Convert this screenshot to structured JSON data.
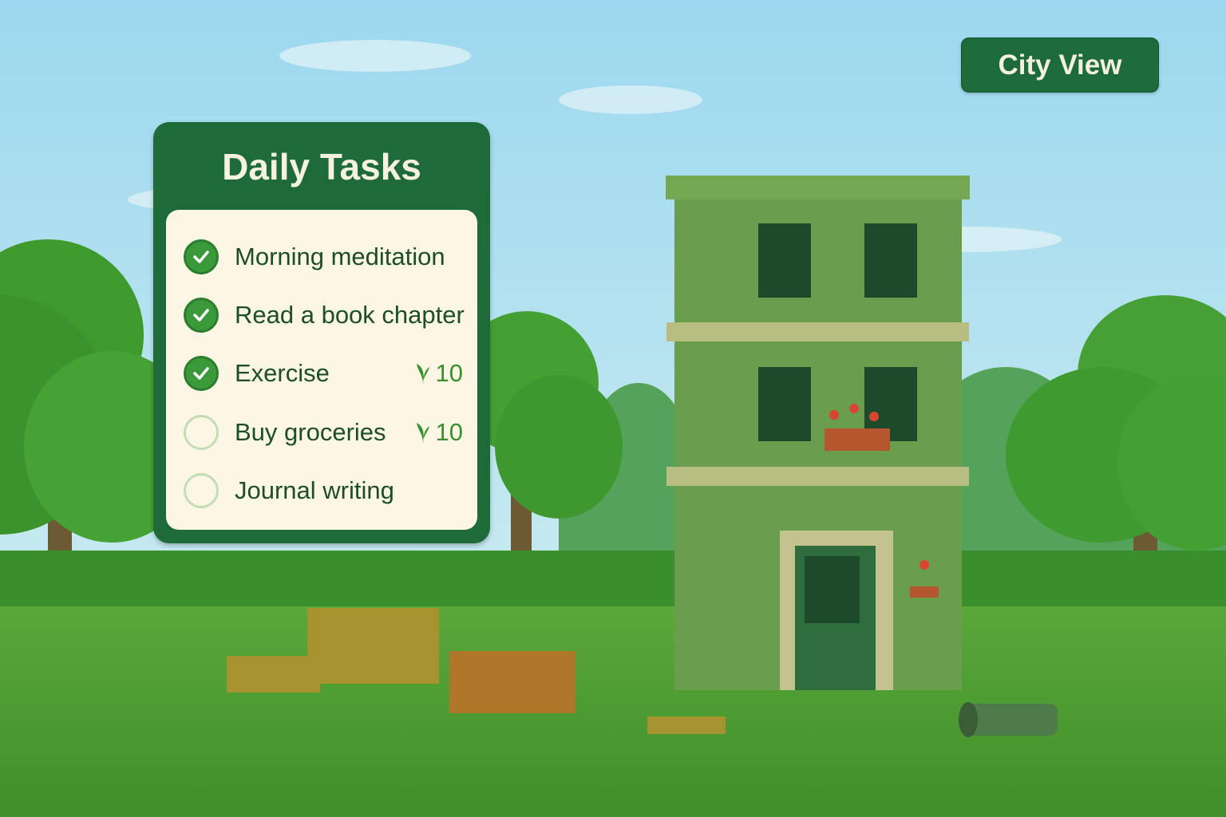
{
  "header": {
    "city_view_label": "City View"
  },
  "daily_tasks": {
    "title": "Daily Tasks",
    "items": [
      {
        "label": "Morning meditation",
        "completed": true,
        "reward": ""
      },
      {
        "label": "Read a book chapter",
        "completed": true,
        "reward": ""
      },
      {
        "label": "Exercise",
        "completed": true,
        "reward": "10"
      },
      {
        "label": "Buy groceries",
        "completed": false,
        "reward": "10"
      },
      {
        "label": "Journal writing",
        "completed": false,
        "reward": ""
      }
    ],
    "reward_icon": "leaf-icon"
  },
  "colors": {
    "panel_green": "#1e6a38",
    "card_cream": "#fbf7e4",
    "check_green": "#3a9a3a",
    "reward_green": "#3b8f2e"
  }
}
